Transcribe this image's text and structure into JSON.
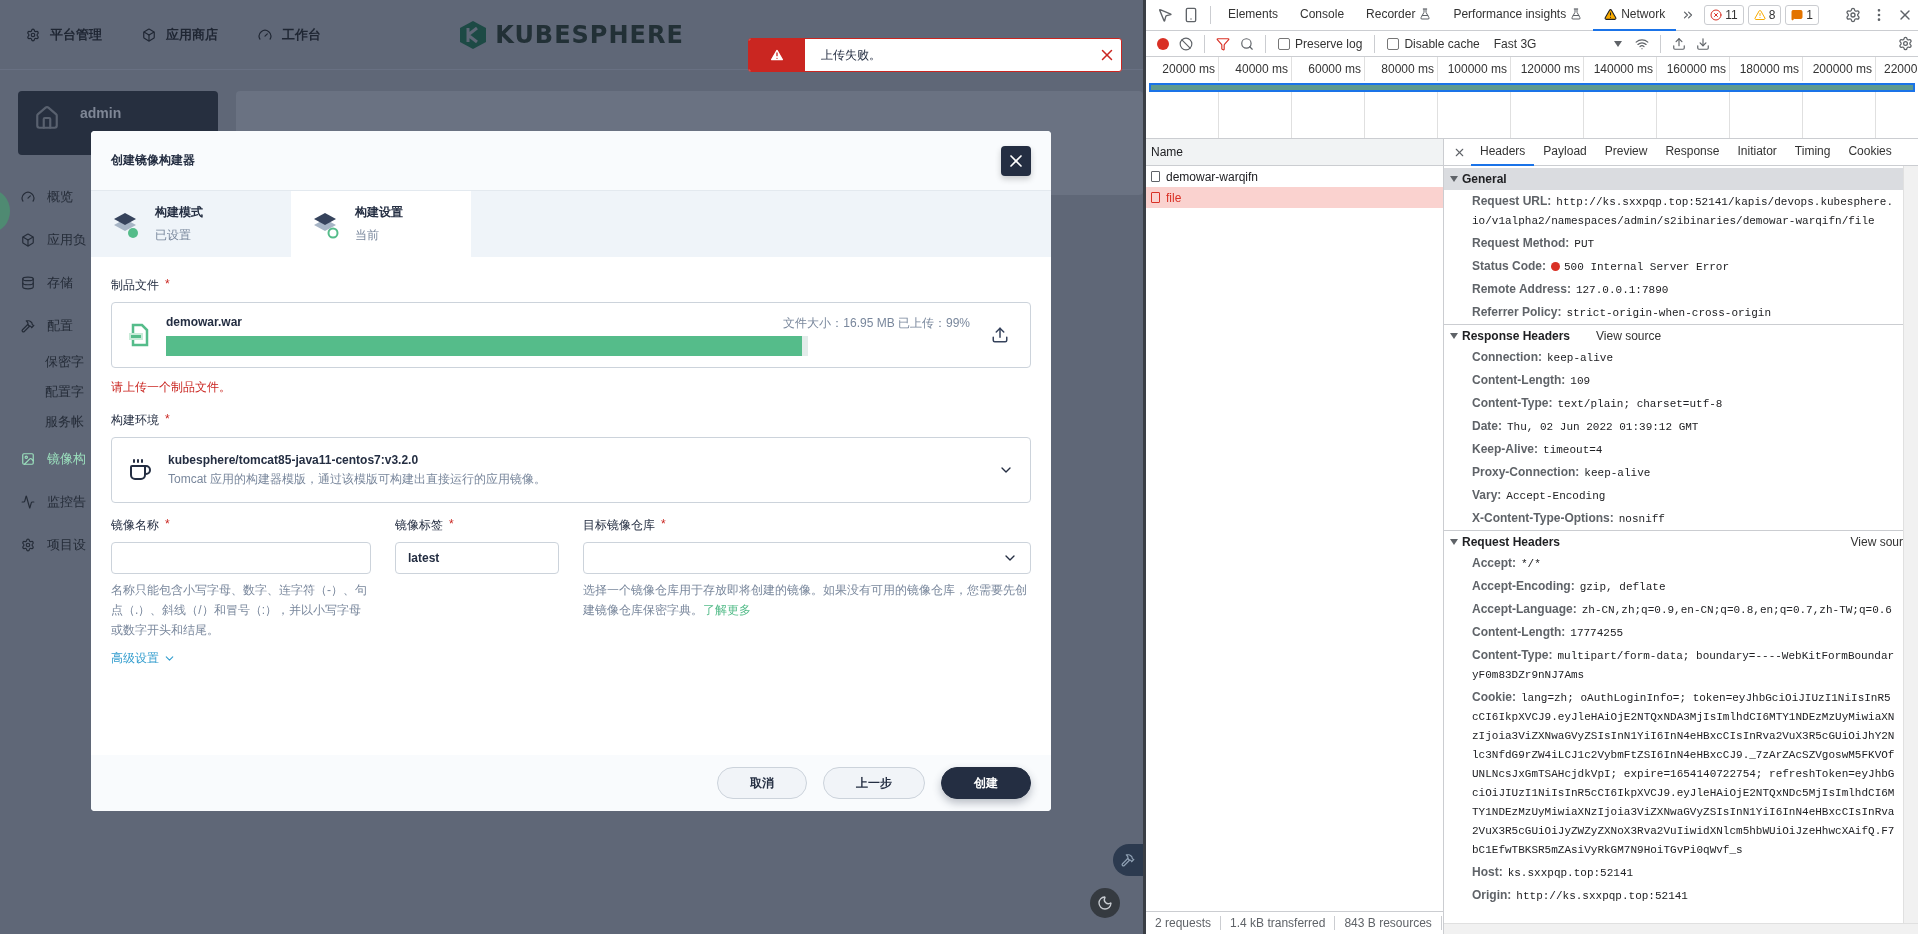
{
  "app": {
    "nav": [
      {
        "label": "平台管理"
      },
      {
        "label": "应用商店"
      },
      {
        "label": "工作台"
      }
    ],
    "logo": "KUBESPHERE",
    "workspace": {
      "name": "admin"
    },
    "sidebar": [
      {
        "label": "概览",
        "selected": false
      },
      {
        "label": "应用负",
        "selected": false
      },
      {
        "label": "存储",
        "selected": false
      },
      {
        "label": "配置",
        "selected": false,
        "children": [
          {
            "label": "保密字",
            "selected": false
          },
          {
            "label": "配置字",
            "selected": false
          },
          {
            "label": "服务帐",
            "selected": false
          }
        ]
      },
      {
        "label": "镜像构",
        "selected": true
      },
      {
        "label": "监控告",
        "selected": false
      },
      {
        "label": "项目设",
        "selected": false
      }
    ]
  },
  "toast": {
    "kind": "error",
    "message": "上传失败。"
  },
  "modal": {
    "title": "创建镜像构建器",
    "steps": [
      {
        "title": "构建模式",
        "status": "已设置",
        "selected": false,
        "done": true
      },
      {
        "title": "构建设置",
        "status": "当前",
        "selected": true,
        "done": false
      }
    ],
    "artifact": {
      "label": "制品文件",
      "required_mark": "*",
      "file_name": "demowar.war",
      "file_info": "文件大小：16.95 MB 已上传：99%",
      "level": 0.99,
      "error": "请上传一个制品文件。"
    },
    "environment": {
      "label": "构建环境",
      "required_mark": "*",
      "image": "kubesphere/tomcat85-java11-centos7:v3.2.0",
      "description": "Tomcat 应用的构建器模版，通过该模版可构建出直接运行的应用镜像。"
    },
    "fields": [
      {
        "kind": "input",
        "label": "镜像名称",
        "required_mark": "*",
        "help": "名称只能包含小写字母、数字、连字符（-）、句点（.）、斜线（/）和冒号（:），并以小写字母或数字开头和结尾。"
      },
      {
        "kind": "input",
        "label": "镜像标签",
        "required_mark": "*",
        "value": "latest"
      },
      {
        "kind": "select",
        "label": "目标镜像仓库",
        "required_mark": "*",
        "help": "选择一个镜像仓库用于存放即将创建的镜像。如果没有可用的镜像仓库，您需要先创建镜像仓库保密字典。",
        "link": "了解更多"
      }
    ],
    "advanced": "高级设置",
    "buttons": [
      {
        "label": "取消",
        "primary": false
      },
      {
        "label": "上一步",
        "primary": false
      },
      {
        "label": "创建",
        "primary": true
      }
    ]
  },
  "devtools": {
    "tabs": [
      {
        "label": "Elements",
        "selected": false,
        "experimental": false,
        "warning": false
      },
      {
        "label": "Console",
        "selected": false,
        "experimental": false,
        "warning": false
      },
      {
        "label": "Recorder",
        "selected": false,
        "experimental": true,
        "warning": false
      },
      {
        "label": "Performance insights",
        "selected": false,
        "experimental": true,
        "warning": false
      },
      {
        "label": "Network",
        "selected": true,
        "experimental": false,
        "warning": true
      }
    ],
    "issues": [
      {
        "kind": "error",
        "count": "11"
      },
      {
        "kind": "warning",
        "count": "8"
      },
      {
        "kind": "info",
        "count": "1"
      }
    ],
    "toolbar": {
      "recording": true,
      "filter_active": true,
      "preserve_log": {
        "label": "Preserve log",
        "checked": false
      },
      "disable_cache": {
        "label": "Disable cache",
        "checked": false
      },
      "throttling": "Fast 3G"
    },
    "timeline": {
      "ticks": [
        "20000 ms",
        "40000 ms",
        "60000 ms",
        "80000 ms",
        "100000 ms",
        "120000 ms",
        "140000 ms",
        "160000 ms",
        "180000 ms",
        "200000 ms",
        "22000"
      ]
    },
    "requests": {
      "column": "Name",
      "rows": [
        {
          "name": "demowar-warqifn",
          "error": false,
          "selected": false
        },
        {
          "name": "file",
          "error": true,
          "selected": true
        }
      ]
    },
    "detail_tabs": [
      {
        "label": "Headers",
        "selected": true
      },
      {
        "label": "Payload",
        "selected": false
      },
      {
        "label": "Preview",
        "selected": false
      },
      {
        "label": "Response",
        "selected": false
      },
      {
        "label": "Initiator",
        "selected": false
      },
      {
        "label": "Timing",
        "selected": false
      },
      {
        "label": "Cookies",
        "selected": false
      }
    ],
    "sections": [
      {
        "title": "General",
        "expanded": true,
        "focused": true,
        "rows": [
          {
            "name": "Request URL:",
            "value": "http://ks.sxxpqp.top:52141/kapis/devops.kubesphere.io/v1alpha2/namespaces/admin/s2ibinaries/demowar-warqifn/file"
          },
          {
            "name": "Request Method:",
            "value": "PUT"
          },
          {
            "name": "Status Code:",
            "value": "500 Internal Server Error",
            "error": true
          },
          {
            "name": "Remote Address:",
            "value": "127.0.0.1:7890"
          },
          {
            "name": "Referrer Policy:",
            "value": "strict-origin-when-cross-origin"
          }
        ]
      },
      {
        "title": "Response Headers",
        "link": "View source",
        "expanded": true,
        "focused": false,
        "rows": [
          {
            "name": "Connection:",
            "value": "keep-alive"
          },
          {
            "name": "Content-Length:",
            "value": "109"
          },
          {
            "name": "Content-Type:",
            "value": "text/plain; charset=utf-8"
          },
          {
            "name": "Date:",
            "value": "Thu, 02 Jun 2022 01:39:12 GMT"
          },
          {
            "name": "Keep-Alive:",
            "value": "timeout=4"
          },
          {
            "name": "Proxy-Connection:",
            "value": "keep-alive"
          },
          {
            "name": "Vary:",
            "value": "Accept-Encoding"
          },
          {
            "name": "X-Content-Type-Options:",
            "value": "nosniff"
          }
        ]
      },
      {
        "title": "Request Headers",
        "link": "View sour",
        "expanded": true,
        "focused": false,
        "rows": [
          {
            "name": "Accept:",
            "value": "*/*"
          },
          {
            "name": "Accept-Encoding:",
            "value": "gzip, deflate"
          },
          {
            "name": "Accept-Language:",
            "value": "zh-CN,zh;q=0.9,en-CN;q=0.8,en;q=0.7,zh-TW;q=0.6"
          },
          {
            "name": "Content-Length:",
            "value": "17774255"
          },
          {
            "name": "Content-Type:",
            "value": "multipart/form-data; boundary=----WebKitFormBoundaryF0m83DZr9nNJ7Ams"
          },
          {
            "name": "Cookie:",
            "value": "lang=zh; oAuthLoginInfo=; token=eyJhbGciOiJIUzI1NiIsInR5cCI6IkpXVCJ9.eyJleHAiOjE2NTQxNDA3MjIsImlhdCI6MTY1NDEzMzUyMiwiaXNzIjoia3ViZXNwaGVyZSIsInN1YiI6InN4eHBxcCIsInRva2VuX3R5cGUiOiJhY2Nlc3NfdG9rZW4iLCJ1c2VybmFtZSI6InN4eHBxcCJ9._7zArZAcSZVgoswM5FKVOfUNLNcsJxGmTSAHcjdkVpI; expire=1654140722754; refreshToken=eyJhbGciOiJIUzI1NiIsInR5cCI6IkpXVCJ9.eyJleHAiOjE2NTQxNDc5MjIsImlhdCI6MTY1NDEzMzUyMiwiaXNzIjoia3ViZXNwaGVyZSIsInN1YiI6InN4eHBxcCIsInRva2VuX3R5cGUiOiJyZWZyZXNoX3Rva2VuIiwidXNlcm5hbWUiOiJzeHhwcXAifQ.F7bC1EfwTBKSR5mZAsiVyRkGM7N9HoiTGvPi0qWvf_s"
          },
          {
            "name": "Host:",
            "value": "ks.sxxpqp.top:52141"
          },
          {
            "name": "Origin:",
            "value": "http://ks.sxxpqp.top:52141"
          }
        ]
      }
    ],
    "status_bar": [
      "2 requests",
      "1.4 kB transferred",
      "843 B resources"
    ]
  }
}
